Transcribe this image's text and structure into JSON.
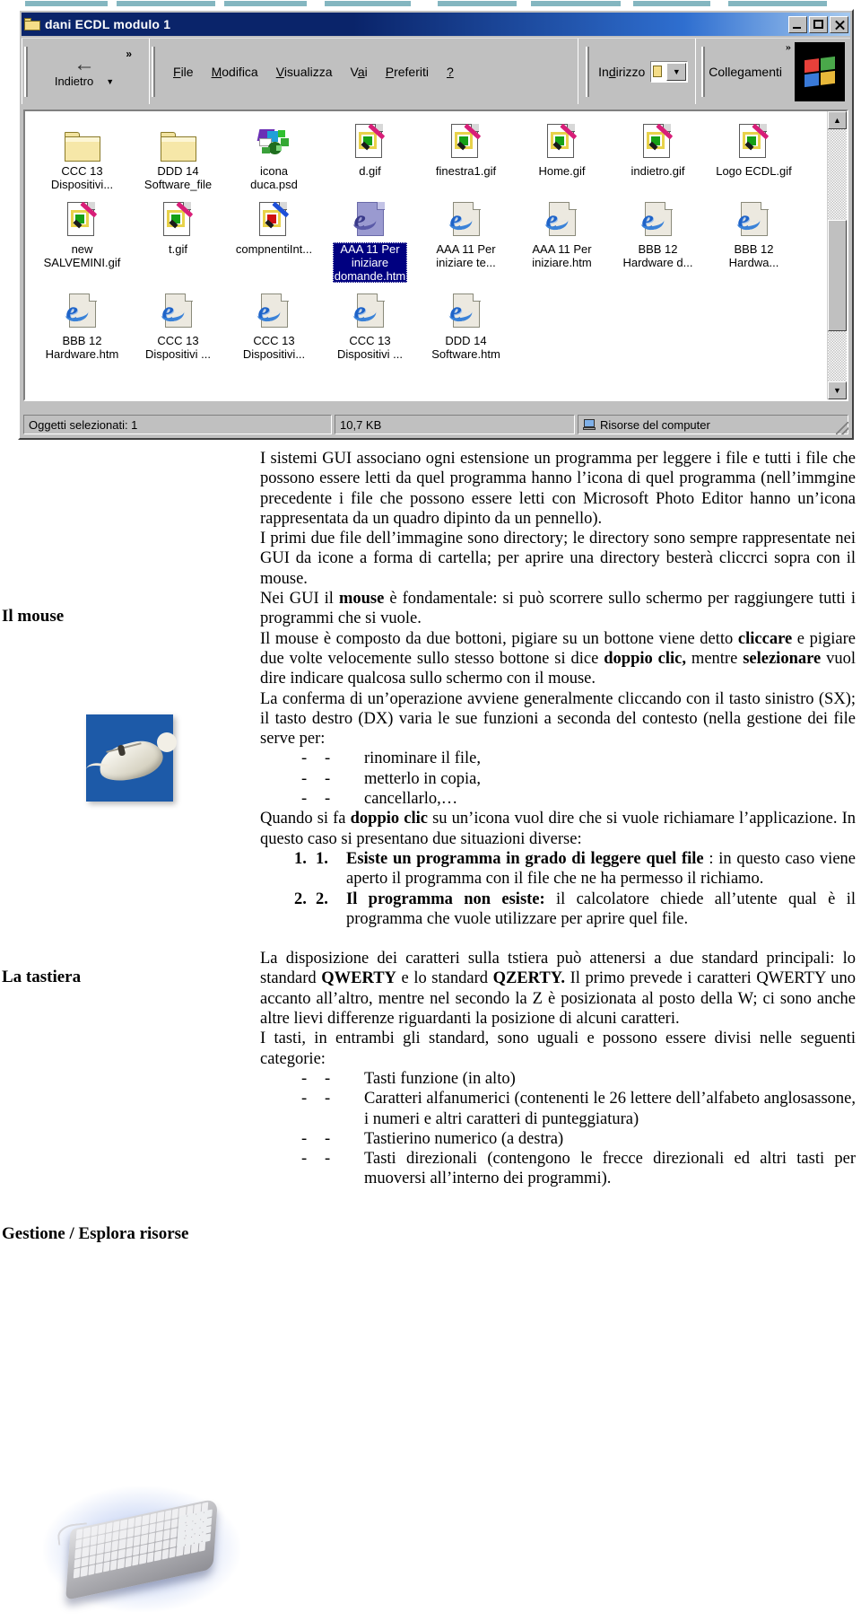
{
  "window": {
    "title": "dani ECDL modulo 1",
    "title_icon": "folder-icon",
    "buttons": {
      "minimize": "minimize-button",
      "maximize": "maximize-button",
      "close": "close-button"
    },
    "toolbar": {
      "back_label": "Indietro",
      "back_icon": "back-arrow-icon",
      "overflow": "»"
    },
    "menu": [
      {
        "label": "File"
      },
      {
        "label": "Modifica"
      },
      {
        "label": "Visualizza"
      },
      {
        "label": "Vai"
      },
      {
        "label": "Preferiti"
      },
      {
        "label": "?"
      }
    ],
    "address": {
      "label": "Indirizzo",
      "value": ""
    },
    "links": {
      "label": "Collegamenti",
      "overflow": "»"
    },
    "status": {
      "objects": "Oggetti selezionati: 1",
      "size": "10,7 KB",
      "location": "Risorse del computer",
      "location_icon": "my-computer-icon"
    },
    "files": [
      [
        {
          "name": "CCC 13\nDispositivi...",
          "icon": "folder-icon",
          "type": "folder",
          "selected": false
        },
        {
          "name": "DDD 14\nSoftware_file",
          "icon": "folder-icon",
          "type": "folder",
          "selected": false
        },
        {
          "name": "icona\nduca.psd",
          "icon": "photoshop-image-icon",
          "type": "psd",
          "selected": false
        },
        {
          "name": "d.gif",
          "icon": "photo-editor-icon",
          "type": "gif",
          "selected": false
        },
        {
          "name": "finestra1.gif",
          "icon": "photo-editor-icon",
          "type": "gif",
          "selected": false
        },
        {
          "name": "Home.gif",
          "icon": "photo-editor-icon",
          "type": "gif",
          "selected": false
        },
        {
          "name": "indietro.gif",
          "icon": "photo-editor-icon",
          "type": "gif",
          "selected": false
        },
        {
          "name": "Logo ECDL.gif",
          "icon": "photo-editor-icon",
          "type": "gif",
          "selected": false
        }
      ],
      [
        {
          "name": "new\nSALVEMINI.gif",
          "icon": "photo-editor-icon",
          "type": "gif",
          "selected": false
        },
        {
          "name": "t.gif",
          "icon": "photo-editor-icon",
          "type": "gif",
          "selected": false
        },
        {
          "name": "compnentiInt...",
          "icon": "photo-editor-icon",
          "type": "gif-red",
          "selected": false
        },
        {
          "name": "AAA 11 Per\niniziare\ndomande.htm",
          "icon": "internet-explorer-icon",
          "type": "htm-purple",
          "selected": true
        },
        {
          "name": "AAA 11 Per\niniziare te...",
          "icon": "internet-explorer-icon",
          "type": "htm",
          "selected": false
        },
        {
          "name": "AAA 11 Per\niniziare.htm",
          "icon": "internet-explorer-icon",
          "type": "htm",
          "selected": false
        },
        {
          "name": "BBB 12\nHardware d...",
          "icon": "internet-explorer-icon",
          "type": "htm",
          "selected": false
        },
        {
          "name": "BBB 12\nHardwa...",
          "icon": "internet-explorer-icon",
          "type": "htm",
          "selected": false
        }
      ],
      [
        {
          "name": "BBB 12\nHardware.htm",
          "icon": "internet-explorer-icon",
          "type": "htm",
          "selected": false
        },
        {
          "name": "CCC 13\nDispositivi ...",
          "icon": "internet-explorer-icon",
          "type": "htm",
          "selected": false
        },
        {
          "name": "CCC 13\nDispositivi...",
          "icon": "internet-explorer-icon",
          "type": "htm",
          "selected": false
        },
        {
          "name": "CCC 13\nDispositivi ...",
          "icon": "internet-explorer-icon",
          "type": "htm",
          "selected": false
        },
        {
          "name": "DDD 14\nSoftware.htm",
          "icon": "internet-explorer-icon",
          "type": "htm",
          "selected": false
        }
      ]
    ]
  },
  "document": {
    "margin_headings": {
      "mouse": "Il mouse",
      "keyboard": "La tastiera",
      "management": "Gestione / Esplora risorse"
    },
    "figures": {
      "mouse": "mouse-photo",
      "keyboard": "keyboard-photo"
    },
    "paragraphs": {
      "p1_a": "I sistemi GUI associano ogni estensione un programma per leggere i file e tutti i file che possono essere letti da quel programma hanno l’icona di quel programma (nell’immgine precedente i file che possono essere letti con Microsoft Photo Editor hanno un’icona rappresentata da un quadro dipinto da un pennello).",
      "p2": "I primi due file dell’immagine sono directory; le directory sono sempre rappresentate nei GUI da icone a forma di cartella; per aprire una directory besterà cliccrci sopra con il mouse.",
      "p3_pre": "Nei GUI il ",
      "p3_b": "mouse",
      "p3_post": " è fondamentale: si può scorrere sullo schermo per raggiungere tutti i programmi che si vuole.",
      "p4_a": "Il mouse è composto da due bottoni, pigiare su un bottone viene detto ",
      "p4_b1": "cliccare",
      "p4_b": " e pigiare due volte velocemente sullo stesso bottone si dice ",
      "p4_b2": "doppio clic,",
      "p4_c": " mentre ",
      "p4_b3": "selezionare",
      "p4_d": " vuol dire indicare qualcosa sullo schermo con il mouse.",
      "p5": "La conferma di un’operazione avviene generalmente cliccando con il tasto sinistro (SX); il tasto destro (DX) varia le sue funzioni a seconda del contesto (nella gestione dei file serve per:",
      "p6_a": "Quando si fa ",
      "p6_b": "doppio clic",
      "p6_c": " su un’icona vuol dire che si vuole richiamare l’applicazione. In questo caso si presentano due situazioni diverse:",
      "p7_a": "La disposizione dei caratteri sulla tstiera può attenersi a due standard principali: lo standard ",
      "p7_b1": "QWERTY",
      "p7_b": " e lo standard ",
      "p7_b2": "QZERTY.",
      "p7_c": "  Il primo prevede i caratteri QWERTY uno accanto all’altro, mentre nel secondo la Z è posizionata al posto della W; ci sono anche altre lievi differenze riguardanti la posizione di alcuni caratteri.",
      "p8": "I tasti, in entrambi gli standard, sono uguali e possono essere divisi nelle seguenti categorie:"
    },
    "bullets_mouse": [
      {
        "d1": "-",
        "d2": "-",
        "text": "rinominare il file,"
      },
      {
        "d1": "-",
        "d2": "-",
        "text": "metterlo in copia,"
      },
      {
        "d1": "-",
        "d2": "-",
        "text": "cancellarlo,…"
      }
    ],
    "numbered": [
      {
        "n1": "1.",
        "n2": "1.",
        "bold": "Esiste un programma in grado di leggere quel file",
        "rest": " : in questo caso viene aperto il programma con il file che ne ha permesso il richiamo."
      },
      {
        "n1": "2.",
        "n2": "2.",
        "bold": "Il programma non esiste:",
        "rest": " il calcolatore chiede all’utente qual è il programma che vuole utilizzare per aprire quel file."
      }
    ],
    "bullets_keyboard": [
      {
        "d1": "-",
        "d2": "-",
        "text": "Tasti funzione (in alto)"
      },
      {
        "d1": "-",
        "d2": "-",
        "text": " Caratteri alfanumerici (contenenti le 26 lettere dell’alfabeto anglosassone, i numeri  e altri caratteri di punteggiatura)"
      },
      {
        "d1": "-",
        "d2": "-",
        "text": "Tastierino numerico (a destra)"
      },
      {
        "d1": "-",
        "d2": "-",
        "text": " Tasti direzionali (contengono le frecce direzionali ed altri tasti per muoversi all’interno dei programmi)."
      }
    ]
  },
  "colors": {
    "titlebar": "#0a246a",
    "window_face": "#c0c0c0",
    "selection": "#000080",
    "folder": "#f6e7a8",
    "ie_blue": "#1e63c8",
    "photo_gold": "#e8d24a"
  }
}
